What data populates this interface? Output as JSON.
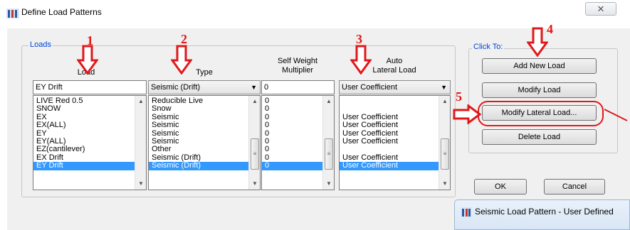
{
  "window": {
    "title": "Define Load Patterns",
    "close_symbol": "✕"
  },
  "loads_group": {
    "label": "Loads",
    "columns": {
      "load": "Load",
      "type": "Type",
      "self_weight": "Self Weight\nMultiplier",
      "auto_lateral": "Auto\nLateral Load"
    },
    "inputs": {
      "load": "EY Drift",
      "type": "Seismic (Drift)",
      "self_weight": "0",
      "auto_lateral": "User Coefficient"
    },
    "rows": [
      {
        "load": "LIVE Red 0.5",
        "type": "Reducible Live",
        "self_weight": "0",
        "auto_lateral": ""
      },
      {
        "load": "SNOW",
        "type": "Snow",
        "self_weight": "0",
        "auto_lateral": ""
      },
      {
        "load": "EX",
        "type": "Seismic",
        "self_weight": "0",
        "auto_lateral": "User Coefficient"
      },
      {
        "load": "EX(ALL)",
        "type": "Seismic",
        "self_weight": "0",
        "auto_lateral": "User Coefficient"
      },
      {
        "load": "EY",
        "type": "Seismic",
        "self_weight": "0",
        "auto_lateral": "User Coefficient"
      },
      {
        "load": "EY(ALL)",
        "type": "Seismic",
        "self_weight": "0",
        "auto_lateral": "User Coefficient"
      },
      {
        "load": "EZ(cantilever)",
        "type": "Other",
        "self_weight": "0",
        "auto_lateral": ""
      },
      {
        "load": "EX Drift",
        "type": "Seismic (Drift)",
        "self_weight": "0",
        "auto_lateral": "User Coefficient"
      },
      {
        "load": "EY Drift",
        "type": "Seismic (Drift)",
        "self_weight": "0",
        "auto_lateral": "User Coefficient",
        "selected": true
      }
    ]
  },
  "click_to": {
    "label": "Click To:",
    "add_new_load": "Add New Load",
    "modify_load": "Modify Load",
    "modify_lateral_load": "Modify Lateral Load...",
    "delete_load": "Delete Load"
  },
  "footer": {
    "ok": "OK",
    "cancel": "Cancel"
  },
  "annotations": {
    "n1": "1",
    "n2": "2",
    "n3": "3",
    "n4": "4",
    "n5": "5",
    "color": "#e0181a"
  },
  "sub_window": {
    "title": "Seismic Load Pattern - User Defined"
  },
  "colors": {
    "selection": "#3399ff",
    "group_label": "#0046d5",
    "dialog_bg": "#f0f0f0"
  }
}
